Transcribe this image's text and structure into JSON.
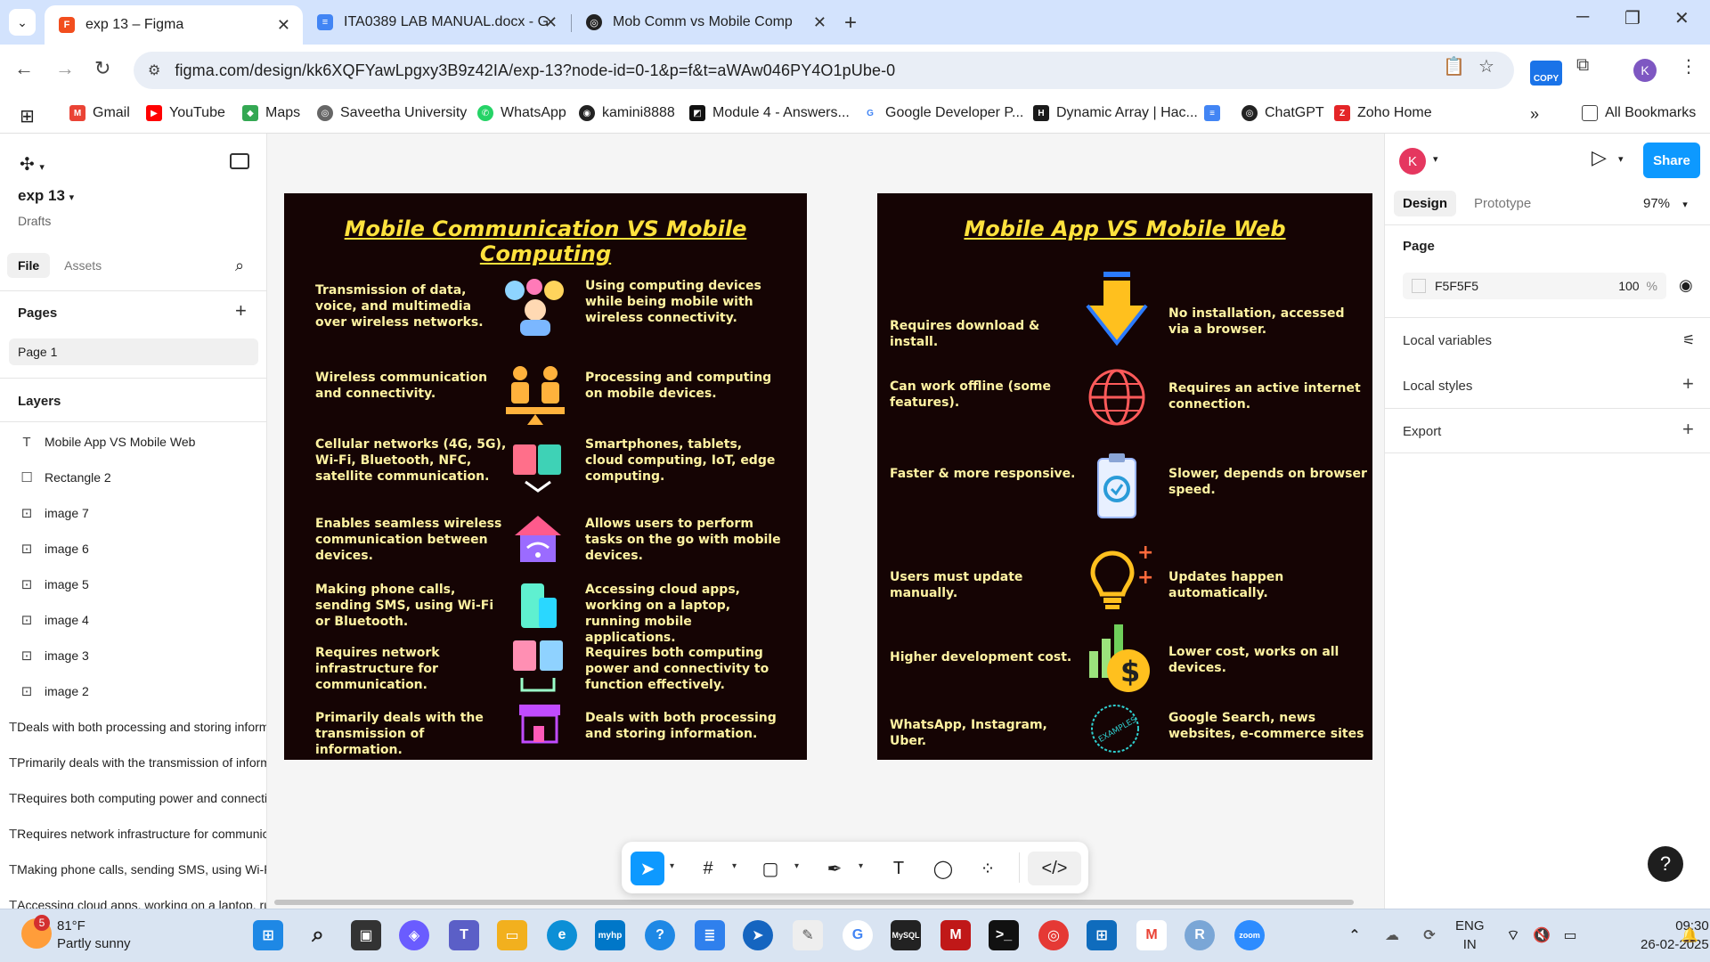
{
  "browser": {
    "tabs": [
      {
        "title": "exp 13 – Figma",
        "active": true
      },
      {
        "title": "ITA0389 LAB MANUAL.docx - G",
        "active": false
      },
      {
        "title": "Mob Comm vs Mobile Comp",
        "active": false
      }
    ],
    "url": "figma.com/design/kk6XQFYawLpgxy3B9z42IA/exp-13?node-id=0-1&p=f&t=aWAw046PY4O1pUbe-0",
    "copy_badge": "COPY",
    "profile_initial": "K",
    "bookmarks": [
      "Gmail",
      "YouTube",
      "Maps",
      "Saveetha University",
      "WhatsApp",
      "kamini8888",
      "Module 4 - Answers...",
      "Google Developer P...",
      "Dynamic Array | Hac...",
      "ChatGPT",
      "Zoho Home"
    ],
    "all_bookmarks": "All Bookmarks"
  },
  "figma": {
    "file_name": "exp 13",
    "file_location": "Drafts",
    "left_tabs": [
      "File",
      "Assets"
    ],
    "pages_title": "Pages",
    "pages": [
      "Page 1"
    ],
    "layers_title": "Layers",
    "layers": [
      {
        "type": "text",
        "name": "Mobile App VS Mobile Web"
      },
      {
        "type": "rect",
        "name": "Rectangle 2"
      },
      {
        "type": "image",
        "name": "image 7"
      },
      {
        "type": "image",
        "name": "image 6"
      },
      {
        "type": "image",
        "name": "image 5"
      },
      {
        "type": "image",
        "name": "image 4"
      },
      {
        "type": "image",
        "name": "image 3"
      },
      {
        "type": "image",
        "name": "image 2"
      },
      {
        "type": "text",
        "name": "Deals with both processing and storing information."
      },
      {
        "type": "text",
        "name": "Primarily deals with the transmission of information."
      },
      {
        "type": "text",
        "name": "Requires both computing power and connectivity to function effectively."
      },
      {
        "type": "text",
        "name": "Requires network infrastructure for communication."
      },
      {
        "type": "text",
        "name": "Making phone calls, sending SMS, using Wi-Fi or Bluetooth."
      },
      {
        "type": "text",
        "name": "Accessing cloud apps, working on a laptop, running mobile applications."
      }
    ],
    "right": {
      "avatar_initial": "K",
      "share_label": "Share",
      "tabs": [
        "Design",
        "Prototype"
      ],
      "zoom": "97%",
      "page_heading": "Page",
      "page_fill_hex": "F5F5F5",
      "page_fill_opacity": "100",
      "percent_sign": "%",
      "sections": [
        "Local variables",
        "Local styles",
        "Export"
      ]
    },
    "help": "?"
  },
  "canvas": {
    "left_frame": {
      "title": "Mobile  Communication VS  Mobile Computing",
      "rows": [
        {
          "left": "Transmission of data, voice, and multimedia over wireless networks.",
          "right": "Using computing devices while being mobile with wireless connectivity."
        },
        {
          "left": "Wireless communication and connectivity.",
          "right": "Processing and computing on mobile devices."
        },
        {
          "left": "Cellular networks (4G, 5G), Wi-Fi, Bluetooth, NFC, satellite communication.",
          "right": "Smartphones, tablets, cloud computing, IoT, edge computing."
        },
        {
          "left": "Enables seamless wireless communication between devices.",
          "right": "Allows users to perform tasks on the go with mobile devices."
        },
        {
          "left": "Making phone calls, sending SMS, using Wi-Fi or Bluetooth.",
          "right": "Accessing cloud apps, working on a laptop, running mobile applications."
        },
        {
          "left": "Requires network infrastructure for communication.",
          "right": "Requires both computing power and connectivity to function effectively."
        },
        {
          "left": "Primarily deals with the transmission of information.",
          "right": "Deals with both processing and storing information."
        }
      ]
    },
    "right_frame": {
      "title": "Mobile App VS  Mobile Web",
      "rows": [
        {
          "left": "Requires download & install.",
          "right": "No installation, accessed via a browser."
        },
        {
          "left": "Can work offline (some features).",
          "right": "Requires an active internet connection."
        },
        {
          "left": "Faster & more responsive.",
          "right": "Slower, depends on browser speed."
        },
        {
          "left": "Users must update manually.",
          "right": "Updates happen automatically."
        },
        {
          "left": "Higher development cost.",
          "right": "Lower cost, works on all devices."
        },
        {
          "left": "WhatsApp, Instagram, Uber.",
          "right": "Google Search, news websites, e-commerce sites"
        }
      ],
      "stamp_text": "EXAMPLES"
    }
  },
  "taskbar": {
    "weather_badge": "5",
    "temperature": "81°F",
    "weather": "Partly sunny",
    "language_1": "ENG",
    "language_2": "IN",
    "time": "09:30",
    "date": "26-02-2025"
  }
}
